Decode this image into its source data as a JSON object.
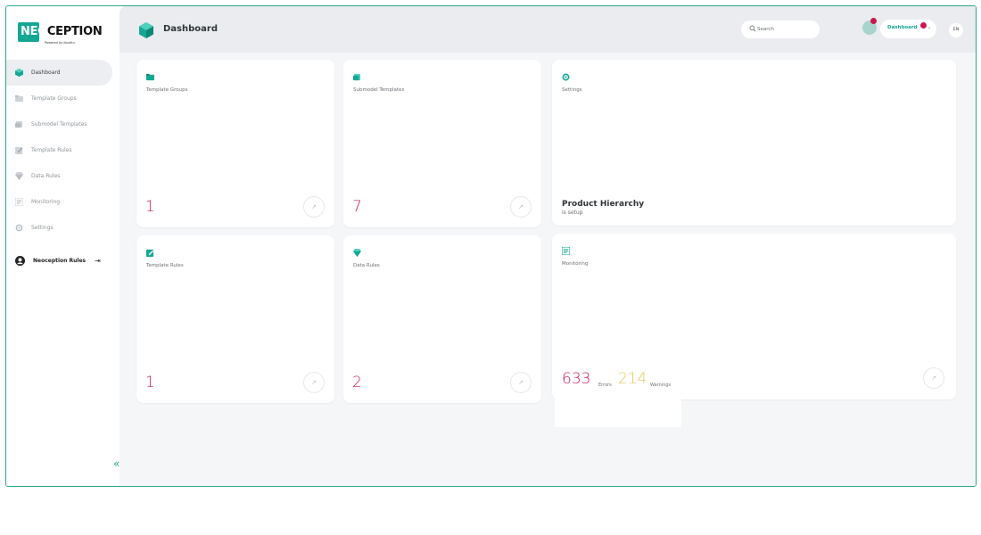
{
  "logo": {
    "text_a": "NEO",
    "text_b": "CEPTION",
    "sub": "Powered by Kontitu"
  },
  "sidebar": {
    "items": [
      {
        "label": "Dashboard",
        "icon": "cube-icon",
        "active": true
      },
      {
        "label": "Template Groups",
        "icon": "folder-icon"
      },
      {
        "label": "Submodel Templates",
        "icon": "stack-icon"
      },
      {
        "label": "Template Rules",
        "icon": "edit-icon"
      },
      {
        "label": "Data Rules",
        "icon": "gem-icon"
      },
      {
        "label": "Monitoring",
        "icon": "list-icon"
      },
      {
        "label": "Settings",
        "icon": "gear-icon"
      }
    ],
    "user": {
      "label": "Neoception Rules",
      "icon": "user-icon",
      "logout_icon": "logout-icon"
    },
    "collapse": "«"
  },
  "topbar": {
    "title": "Dashboard",
    "search_placeholder": "Search",
    "user_label": "Dashboard",
    "lang": "EN"
  },
  "cards": {
    "template_groups": {
      "label": "Template Groups",
      "count": "1"
    },
    "submodel_templates": {
      "label": "Submodel Templates",
      "count": "7"
    },
    "settings": {
      "label": "Settings",
      "title": "Product Hierarchy",
      "subtitle": "is setup"
    },
    "template_rules": {
      "label": "Template Rules",
      "count": "1"
    },
    "data_rules": {
      "label": "Data Rules",
      "count": "2"
    },
    "monitoring": {
      "label": "Monitoring",
      "errors": "633",
      "errors_label": "Errors",
      "warnings": "214",
      "warnings_label": "Warnings"
    },
    "arrow": "↗"
  },
  "colors": {
    "accent": "#14a894",
    "count": "#c8184f",
    "warning": "#e8c75a",
    "border": "#2fa58f"
  }
}
